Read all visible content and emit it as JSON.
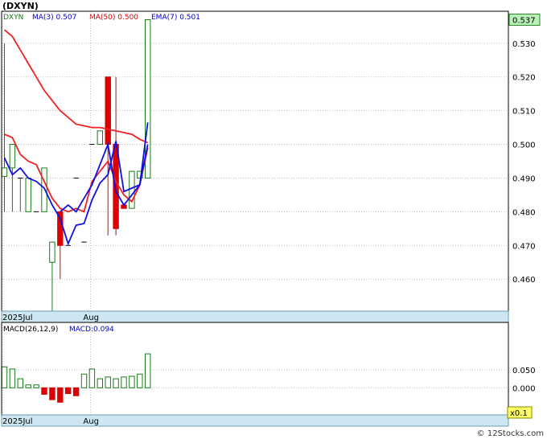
{
  "header": {
    "symbol": "(DXYN)",
    "legend": [
      {
        "label": "DXYN",
        "color": "#1a7a1a"
      },
      {
        "label": "MA(3)  0.507",
        "color": "#0000cc"
      },
      {
        "label": "MA(50)  0.500",
        "color": "#cc0000"
      },
      {
        "label": "EMA(7)  0.501",
        "color": "#0000cc"
      }
    ]
  },
  "macd_header": [
    {
      "label": "MACD(26,12,9)",
      "color": "#000000"
    },
    {
      "label": "MACD:0.094",
      "color": "#0000cc"
    }
  ],
  "footer": {
    "credit": "© 12Stocks.com",
    "scale_badge": "x0.1"
  },
  "colors": {
    "up": "#1a7a1a",
    "down": "#dd0000",
    "ma_red": "#ee2222",
    "ma_blue": "#1111dd",
    "axis_bar": "#cde6f2",
    "last_price_bg": "#b8f0b8"
  },
  "chart_data": [
    {
      "type": "candlestick",
      "title": "DXYN",
      "ylim": [
        0.4505,
        0.5395
      ],
      "yticks": [
        0.46,
        0.47,
        0.48,
        0.49,
        0.5,
        0.51,
        0.52,
        0.53
      ],
      "ytick_labels": [
        "0.460",
        "0.470",
        "0.480",
        "0.490",
        "0.500",
        "0.510",
        "0.520",
        "0.530"
      ],
      "last_price_label": "0.537",
      "last_price": 0.537,
      "x_labels": [
        {
          "label": "2025Jul",
          "index": 0
        },
        {
          "label": "Aug",
          "index": 11
        }
      ],
      "grid": true,
      "candles": [
        {
          "o": 0.4905,
          "h": 0.53,
          "l": 0.48,
          "c": 0.493
        },
        {
          "o": 0.493,
          "h": 0.5,
          "l": 0.48,
          "c": 0.5
        },
        {
          "o": 0.49,
          "h": 0.49,
          "l": 0.48,
          "c": 0.49
        },
        {
          "o": 0.48,
          "h": 0.49,
          "l": 0.48,
          "c": 0.49
        },
        {
          "o": 0.48,
          "h": 0.48,
          "l": 0.48,
          "c": 0.48
        },
        {
          "o": 0.48,
          "h": 0.493,
          "l": 0.48,
          "c": 0.493
        },
        {
          "o": 0.465,
          "h": 0.471,
          "l": 0.4505,
          "c": 0.471
        },
        {
          "o": 0.48,
          "h": 0.48,
          "l": 0.46,
          "c": 0.47
        },
        {
          "o": 0.47,
          "h": 0.47,
          "l": 0.47,
          "c": 0.47
        },
        {
          "o": 0.49,
          "h": 0.49,
          "l": 0.49,
          "c": 0.49
        },
        {
          "o": 0.471,
          "h": 0.471,
          "l": 0.471,
          "c": 0.471
        },
        {
          "o": 0.5,
          "h": 0.5,
          "l": 0.5,
          "c": 0.5
        },
        {
          "o": 0.5,
          "h": 0.504,
          "l": 0.5,
          "c": 0.504
        },
        {
          "o": 0.52,
          "h": 0.52,
          "l": 0.473,
          "c": 0.5
        },
        {
          "o": 0.5,
          "h": 0.52,
          "l": 0.473,
          "c": 0.475
        },
        {
          "o": 0.482,
          "h": 0.482,
          "l": 0.481,
          "c": 0.481
        },
        {
          "o": 0.481,
          "h": 0.492,
          "l": 0.481,
          "c": 0.492
        },
        {
          "o": 0.49,
          "h": 0.492,
          "l": 0.49,
          "c": 0.492
        },
        {
          "o": 0.49,
          "h": 0.537,
          "l": 0.49,
          "c": 0.537
        }
      ],
      "series": [
        {
          "label": "MA(50)",
          "color": "#ee2222",
          "values": [
            0.534,
            0.532,
            0.528,
            0.524,
            0.52,
            0.516,
            0.513,
            0.51,
            0.508,
            0.506,
            0.5055,
            0.505,
            0.505,
            0.5045,
            0.504,
            0.5035,
            0.503,
            0.5015,
            0.5005
          ]
        },
        {
          "label": "EMA(7)",
          "color": "#ee2222",
          "values": [
            0.503,
            0.502,
            0.497,
            0.495,
            0.494,
            0.489,
            0.484,
            0.481,
            0.48,
            0.481,
            0.48,
            0.489,
            0.492,
            0.495,
            0.489,
            0.485,
            0.483,
            0.488,
            0.499
          ]
        },
        {
          "label": "MA(3)",
          "color": "#1111dd",
          "values": [
            0.496,
            0.491,
            0.493,
            0.49,
            0.489,
            0.487,
            0.482,
            0.478,
            0.4705,
            0.476,
            0.4765,
            0.4835,
            0.4885,
            0.491,
            0.501,
            0.486,
            0.487,
            0.488,
            0.5065
          ]
        },
        {
          "label": "MA(3)b",
          "color": "#1111dd",
          "values": [
            null,
            null,
            null,
            null,
            null,
            null,
            null,
            0.48,
            0.482,
            0.48,
            0.484,
            0.488,
            0.494,
            0.5,
            0.486,
            0.482,
            0.485,
            0.488,
            0.5
          ]
        }
      ]
    },
    {
      "type": "bar",
      "title": "MACD(26,12,9)",
      "ylim": [
        -0.075,
        0.181
      ],
      "yticks": [
        0.0,
        0.05
      ],
      "ytick_labels": [
        "0.000",
        "0.050"
      ],
      "x_labels": [
        {
          "label": "2025Jul",
          "index": 0
        },
        {
          "label": "Aug",
          "index": 11
        }
      ],
      "grid": true,
      "values": [
        0.058,
        0.052,
        0.025,
        0.008,
        0.008,
        -0.018,
        -0.033,
        -0.04,
        -0.016,
        -0.022,
        0.038,
        0.052,
        0.025,
        0.03,
        0.025,
        0.03,
        0.032,
        0.038,
        0.094
      ]
    }
  ]
}
